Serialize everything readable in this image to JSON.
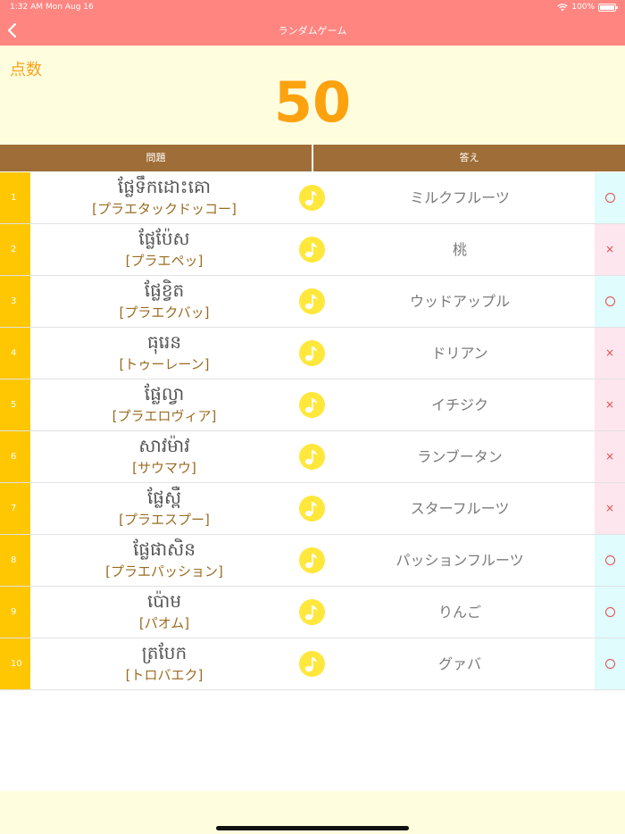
{
  "status_bar": {
    "time": "1:32 AM",
    "date": "Mon Aug 16",
    "battery": "100%"
  },
  "nav": {
    "title": "ランダムゲーム",
    "back_icon": "chevron-left-icon"
  },
  "score": {
    "label": "点数",
    "value": "50"
  },
  "table": {
    "headers": {
      "question": "問題",
      "answer": "答え"
    },
    "rows": [
      {
        "num": "1",
        "khmer": "ផ្លែទឹកដោះគោ",
        "kana": "[プラエタックドッコー]",
        "answer": "ミルクフルーツ",
        "result": "correct"
      },
      {
        "num": "2",
        "khmer": "ផ្លែប៉ែស",
        "kana": "[プラエペッ]",
        "answer": "桃",
        "result": "wrong"
      },
      {
        "num": "3",
        "khmer": "ផ្លែខ្វិត",
        "kana": "[プラエクバッ]",
        "answer": "ウッドアップル",
        "result": "correct"
      },
      {
        "num": "4",
        "khmer": "ធុរេន",
        "kana": "[トゥーレーン]",
        "answer": "ドリアン",
        "result": "wrong"
      },
      {
        "num": "5",
        "khmer": "ផ្លែល្វា",
        "kana": "[プラエロヴィア]",
        "answer": "イチジク",
        "result": "wrong"
      },
      {
        "num": "6",
        "khmer": "សាវម៉ាវ",
        "kana": "[サウマウ]",
        "answer": "ランブータン",
        "result": "wrong"
      },
      {
        "num": "7",
        "khmer": "ផ្លែស្ពឺ",
        "kana": "[プラエスプー]",
        "answer": "スターフルーツ",
        "result": "wrong"
      },
      {
        "num": "8",
        "khmer": "ផ្លែផាសិន",
        "kana": "[プラエパッション]",
        "answer": "パッションフルーツ",
        "result": "correct"
      },
      {
        "num": "9",
        "khmer": "ប៉ោម",
        "kana": "[パオム]",
        "answer": "りんご",
        "result": "correct"
      },
      {
        "num": "10",
        "khmer": "ត្របែក",
        "kana": "[トロバエク]",
        "answer": "グァバ",
        "result": "correct"
      }
    ]
  },
  "marks": {
    "correct": "○",
    "wrong": "×"
  },
  "colors": {
    "nav": "#fe8580",
    "score": "#fca20f",
    "header": "#9f6d37",
    "num_bg": "#fec701",
    "sound": "#ffe73c"
  }
}
